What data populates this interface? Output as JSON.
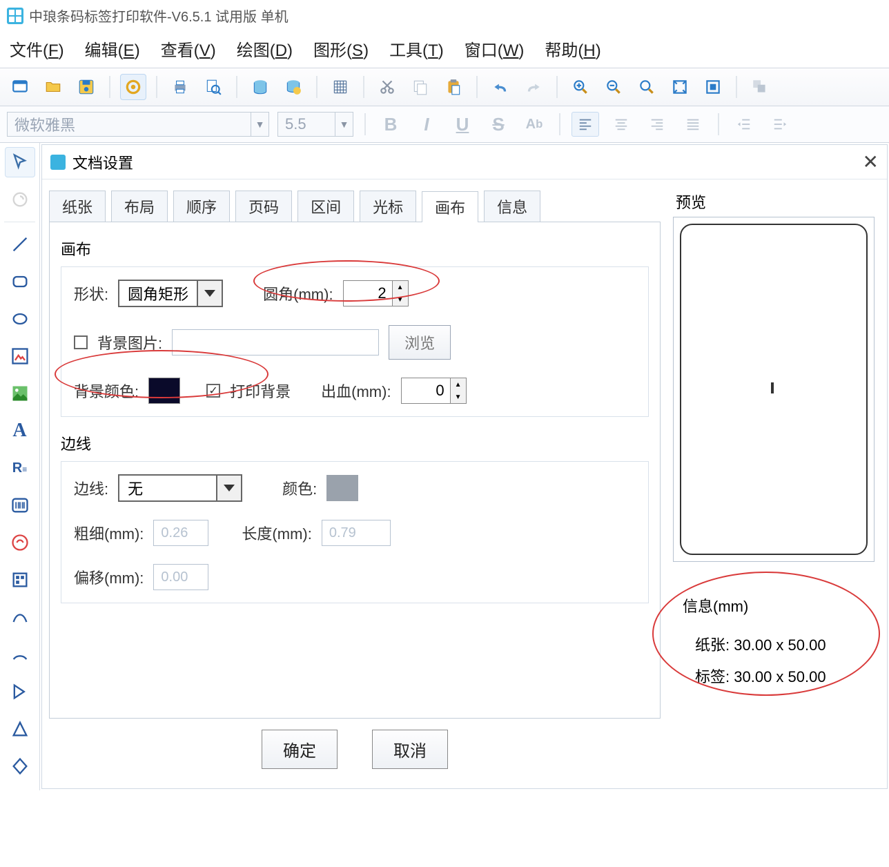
{
  "titlebar": {
    "title": "中琅条码标签打印软件-V6.5.1 试用版 单机"
  },
  "menu": {
    "file": "文件(",
    "file_u": "F",
    "file_end": ")",
    "edit": "编辑(",
    "edit_u": "E",
    "edit_end": ")",
    "view": "查看(",
    "view_u": "V",
    "view_end": ")",
    "draw": "绘图(",
    "draw_u": "D",
    "draw_end": ")",
    "shape": "图形(",
    "shape_u": "S",
    "shape_end": ")",
    "tool": "工具(",
    "tool_u": "T",
    "tool_end": ")",
    "window": "窗口(",
    "window_u": "W",
    "window_end": ")",
    "help": "帮助(",
    "help_u": "H",
    "help_end": ")"
  },
  "formatbar": {
    "font_placeholder": "微软雅黑",
    "size_placeholder": "5.5"
  },
  "dialog": {
    "title": "文档设置",
    "tabs": [
      "纸张",
      "布局",
      "顺序",
      "页码",
      "区间",
      "光标",
      "画布",
      "信息"
    ],
    "active_tab_index": 6,
    "canvas": {
      "group_title": "画布",
      "shape_label": "形状:",
      "shape_value": "圆角矩形",
      "radius_label": "圆角(mm):",
      "radius_value": "2",
      "bgimg_label": "背景图片:",
      "browse_btn": "浏览",
      "bgcolor_label": "背景颜色:",
      "bgcolor_value": "#0a0a2a",
      "print_bg_label": "打印背景",
      "bleed_label": "出血(mm):",
      "bleed_value": "0"
    },
    "border": {
      "group_title": "边线",
      "line_label": "边线:",
      "line_value": "无",
      "color_label": "颜色:",
      "color_value": "#9aa2ac",
      "width_label": "粗细(mm):",
      "width_value": "0.26",
      "length_label": "长度(mm):",
      "length_value": "0.79",
      "offset_label": "偏移(mm):",
      "offset_value": "0.00"
    },
    "preview_label": "预览",
    "info": {
      "title": "信息(mm)",
      "paper_label": "纸张:",
      "paper_value": "30.00 x 50.00",
      "label_label": "标签:",
      "label_value": "30.00 x 50.00"
    },
    "ok": "确定",
    "cancel": "取消"
  }
}
